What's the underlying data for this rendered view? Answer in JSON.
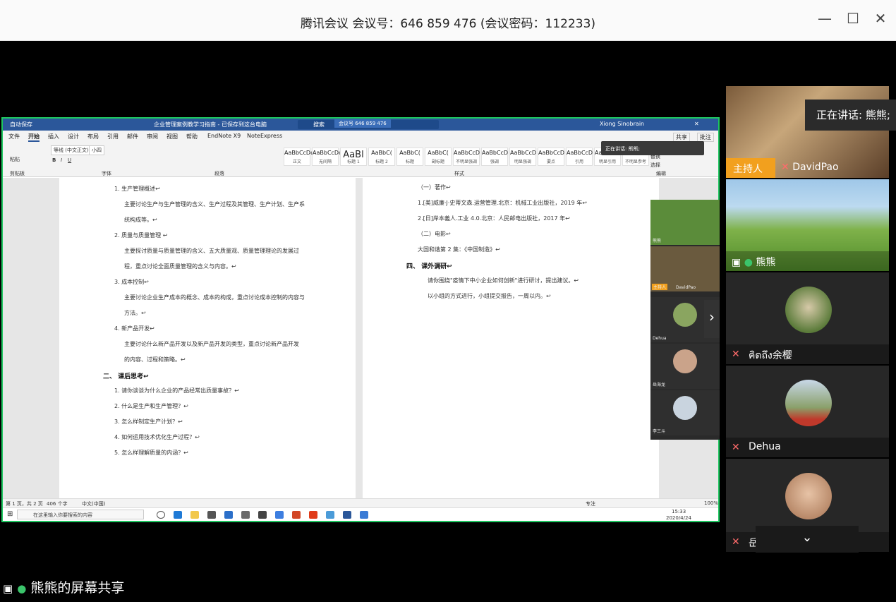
{
  "window": {
    "title": "腾讯会议 会议号：646 859 476  (会议密码：112233)",
    "minimize_icon": "minimize-icon",
    "maximize_icon": "maximize-icon",
    "close_icon": "close-icon"
  },
  "word": {
    "autosave": "自动保存",
    "doc_title": "企业管理案例教学习指南 - 已保存到这台电脑",
    "search": "搜索",
    "meeting_chip": "会议号 646 859 476",
    "user": "Xiong Sinobrain",
    "tabs": [
      "文件",
      "开始",
      "插入",
      "设计",
      "布局",
      "引用",
      "邮件",
      "审阅",
      "视图",
      "帮助",
      "EndNote X9",
      "NoteExpress"
    ],
    "share_label": "共享",
    "comment_label": "批注",
    "paste": "粘贴",
    "clipboard": "剪贴板",
    "font_name": "等线 (中文正文)",
    "font_size": "小四",
    "font_group": "字体",
    "paragraph_group": "段落",
    "styles_group": "样式",
    "editing_group": "编辑",
    "styles": [
      {
        "preview": "AaBbCcDc",
        "label": "正文"
      },
      {
        "preview": "AaBbCcDc",
        "label": "无间隔"
      },
      {
        "preview": "AaBl",
        "label": "标题 1"
      },
      {
        "preview": "AaBbC(",
        "label": "标题 2"
      },
      {
        "preview": "AaBbC(",
        "label": "标题"
      },
      {
        "preview": "AaBbC(",
        "label": "副标题"
      },
      {
        "preview": "AaBbCcD",
        "label": "不明显强调"
      },
      {
        "preview": "AaBbCcD",
        "label": "强调"
      },
      {
        "preview": "AaBbCcD",
        "label": "明显强调"
      },
      {
        "preview": "AaBbCcD",
        "label": "要点"
      },
      {
        "preview": "AaBbCcD",
        "label": "引用"
      },
      {
        "preview": "AaBbCcD",
        "label": "明显引用"
      },
      {
        "preview": "",
        "label": "不明显参考"
      }
    ],
    "find": "查找",
    "replace": "替换",
    "select": "选择",
    "speaking_tip": "正在讲话: 熊熊;",
    "left_page": [
      {
        "text": "1.  生产管理概述↩",
        "indent": 1
      },
      {
        "text": "主要讨论生产与生产管理的含义、生产过程及其管理、生产计划、生产系",
        "indent": 2
      },
      {
        "text": "统构成等。↩",
        "indent": 2
      },
      {
        "text": "2.  质量与质量管理 ↩",
        "indent": 1
      },
      {
        "text": "主要探讨质量与质量管理的含义、五大质量观、质量管理理论的发展过",
        "indent": 2
      },
      {
        "text": "程，重点讨论全面质量管理的含义与内容。↩",
        "indent": 2
      },
      {
        "text": "3.  成本控制↩",
        "indent": 1
      },
      {
        "text": "主要讨论企业生产成本的概念、成本的构成，重点讨论成本控制的内容与",
        "indent": 2
      },
      {
        "text": "方法。↩",
        "indent": 2
      },
      {
        "text": "4.  新产品开发↩",
        "indent": 1
      },
      {
        "text": "主要讨论什么新产品开发以及新产品开发的类型，重点讨论新产品开发",
        "indent": 2
      },
      {
        "text": "的内容、过程和策略。↩",
        "indent": 2
      },
      {
        "text": "二、    课后思考↩",
        "indent": 0
      },
      {
        "text": "1.  请你谈谈为什么企业的产品经常出质量事故？↩",
        "indent": 1
      },
      {
        "text": "2.  什么是生产和生产管理？↩",
        "indent": 1
      },
      {
        "text": "3.  怎么样制定生产计划？↩",
        "indent": 1
      },
      {
        "text": "4.  如何运用技术优化生产过程？↩",
        "indent": 1
      },
      {
        "text": "5.  怎么样理解质量的内涵？↩",
        "indent": 1
      }
    ],
    "right_page": [
      {
        "text": "（一）著作↩",
        "indent": 1
      },
      {
        "text": "1.[美]威廉·J·史蒂文森.运营管理.北京：机械工业出版社，2019 年↩",
        "indent": 1
      },
      {
        "text": "2.[日]岸本義人.工业 4.0.北京：人民邮电出版社，2017 年↩",
        "indent": 1
      },
      {
        "text": "（二）电影↩",
        "indent": 1
      },
      {
        "text": "大国和谐第 2 集：《中国制造》↩",
        "indent": 1
      },
      {
        "text": "四、    课外调研↩",
        "indent": 0
      },
      {
        "text": "请你围绕\"疫情下中小企业如何创新\"进行研讨，提出建议。↩",
        "indent": 2
      },
      {
        "text": "以小组的方式进行，小组提交报告，一周以内。↩",
        "indent": 2
      }
    ],
    "status_pages": "第 1 页，共 2 页",
    "status_words": "406 个字",
    "status_lang": "中文(中国)",
    "status_focus": "专注",
    "status_zoom": "100%",
    "taskbar_search": "在这里输入你要搜索的内容",
    "clock_time": "15:33",
    "clock_date": "2020/4/24"
  },
  "mini_strip": [
    {
      "name": "熊熊"
    },
    {
      "name": "DavidPao",
      "host": "主持人"
    },
    {
      "name": "Dehua"
    },
    {
      "name": "岳海龙"
    },
    {
      "name": "李三斗"
    }
  ],
  "sharer_label": "熊熊的屏幕共享",
  "speaking_now": "正在讲话: 熊熊;",
  "participants": [
    {
      "name": "DavidPao",
      "host_badge": "主持人",
      "muted": true
    },
    {
      "name": "熊熊",
      "muted": false
    },
    {
      "name": "คิดถึง余樱",
      "muted": true
    },
    {
      "name": "Dehua",
      "muted": true
    },
    {
      "name": "岳海龙",
      "muted": true
    }
  ],
  "colors": {
    "share_border": "#1ec760",
    "host_badge": "#f2a01e",
    "word_blue": "#2b579a",
    "muted_red": "#e23b3b"
  }
}
